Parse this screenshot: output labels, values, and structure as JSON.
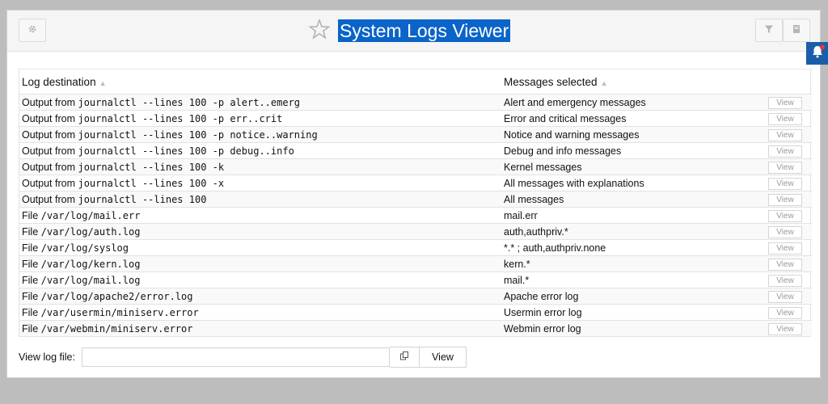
{
  "header": {
    "title": "System Logs Viewer"
  },
  "table": {
    "columns": [
      "Log destination",
      "Messages selected"
    ],
    "view_label": "View",
    "rows": [
      {
        "prefix": "Output from",
        "path": "journalctl --lines 100 -p alert..emerg",
        "messages": "Alert and emergency messages"
      },
      {
        "prefix": "Output from",
        "path": "journalctl --lines 100 -p err..crit",
        "messages": "Error and critical messages"
      },
      {
        "prefix": "Output from",
        "path": "journalctl --lines 100 -p notice..warning",
        "messages": "Notice and warning messages"
      },
      {
        "prefix": "Output from",
        "path": "journalctl --lines 100 -p debug..info",
        "messages": "Debug and info messages"
      },
      {
        "prefix": "Output from",
        "path": "journalctl --lines 100 -k",
        "messages": "Kernel messages"
      },
      {
        "prefix": "Output from",
        "path": "journalctl --lines 100 -x",
        "messages": "All messages with explanations"
      },
      {
        "prefix": "Output from",
        "path": "journalctl --lines 100",
        "messages": "All messages"
      },
      {
        "prefix": "File",
        "path": "/var/log/mail.err",
        "messages": "mail.err"
      },
      {
        "prefix": "File",
        "path": "/var/log/auth.log",
        "messages": "auth,authpriv.*"
      },
      {
        "prefix": "File",
        "path": "/var/log/syslog",
        "messages": "*.* ; auth,authpriv.none"
      },
      {
        "prefix": "File",
        "path": "/var/log/kern.log",
        "messages": "kern.*"
      },
      {
        "prefix": "File",
        "path": "/var/log/mail.log",
        "messages": "mail.*"
      },
      {
        "prefix": "File",
        "path": "/var/log/apache2/error.log",
        "messages": "Apache error log"
      },
      {
        "prefix": "File",
        "path": "/var/usermin/miniserv.error",
        "messages": "Usermin error log"
      },
      {
        "prefix": "File",
        "path": "/var/webmin/miniserv.error",
        "messages": "Webmin error log"
      }
    ]
  },
  "footer": {
    "label": "View log file:",
    "input_value": "",
    "view_button": "View"
  },
  "icons": {
    "settings": "gear-icon",
    "favorite": "star-outline-icon",
    "filter": "filter-icon",
    "book": "book-icon",
    "notifications": "bell-icon",
    "copy": "copy-icon"
  },
  "colors": {
    "title_highlight": "#0a64c9",
    "notification_tab": "#1a5ea8",
    "notification_badge": "#e53935"
  }
}
